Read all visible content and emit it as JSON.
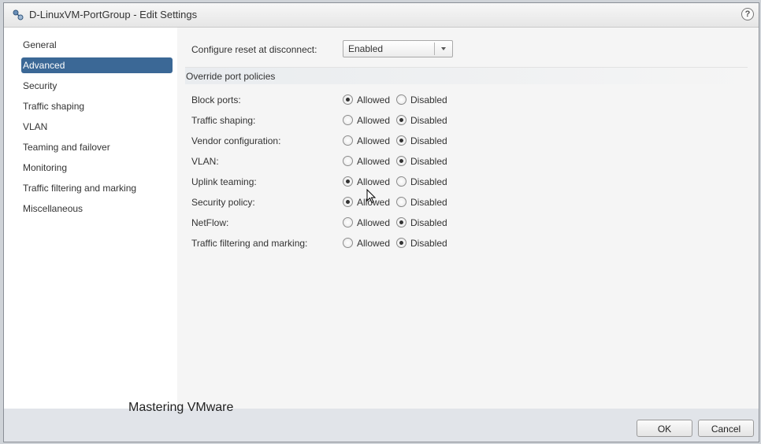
{
  "window": {
    "title": "D-LinuxVM-PortGroup - Edit Settings",
    "help_label": "?"
  },
  "sidebar": {
    "items": [
      {
        "label": "General",
        "active": false
      },
      {
        "label": "Advanced",
        "active": true
      },
      {
        "label": "Security",
        "active": false
      },
      {
        "label": "Traffic shaping",
        "active": false
      },
      {
        "label": "VLAN",
        "active": false
      },
      {
        "label": "Teaming and failover",
        "active": false
      },
      {
        "label": "Monitoring",
        "active": false
      },
      {
        "label": "Traffic filtering and marking",
        "active": false
      },
      {
        "label": "Miscellaneous",
        "active": false
      }
    ]
  },
  "main": {
    "reset_label": "Configure reset at disconnect:",
    "reset_value": "Enabled",
    "section_title": "Override port policies",
    "option_allowed": "Allowed",
    "option_disabled": "Disabled",
    "policies": [
      {
        "label": "Block ports:",
        "selected": "Allowed"
      },
      {
        "label": "Traffic shaping:",
        "selected": "Disabled"
      },
      {
        "label": "Vendor configuration:",
        "selected": "Disabled"
      },
      {
        "label": "VLAN:",
        "selected": "Disabled"
      },
      {
        "label": "Uplink teaming:",
        "selected": "Allowed"
      },
      {
        "label": "Security policy:",
        "selected": "Allowed"
      },
      {
        "label": "NetFlow:",
        "selected": "Disabled"
      },
      {
        "label": "Traffic filtering and marking:",
        "selected": "Disabled"
      }
    ]
  },
  "footer": {
    "watermark": "Mastering VMware",
    "ok_label": "OK",
    "cancel_label": "Cancel"
  },
  "colors": {
    "active_nav": "#3b6896",
    "footer_bg": "#e1e4e9",
    "content_bg": "#f5f5f5"
  }
}
